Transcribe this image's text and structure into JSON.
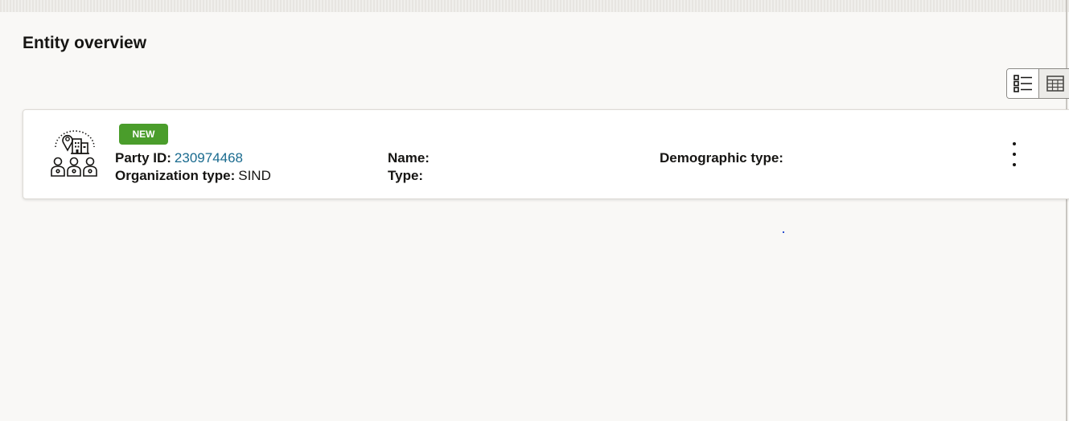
{
  "page": {
    "title": "Entity overview"
  },
  "view_toggle": {
    "list_icon": "list-view-icon",
    "table_icon": "table-view-icon",
    "selected": "list"
  },
  "entity_card": {
    "icon": "organization-people-icon",
    "badge": "NEW",
    "party_id_label": "Party ID:",
    "party_id_value": "230974468",
    "org_type_label": "Organization type:",
    "org_type_value": "SIND",
    "name_label": "Name:",
    "name_value": "",
    "type_label": "Type:",
    "type_value": "",
    "demographic_label": "Demographic type:",
    "demographic_value": "",
    "menu_icon": "more-vertical-icon"
  },
  "colors": {
    "badge": "#4a9d2b",
    "link": "#1a6b8f",
    "background": "#f9f8f6"
  }
}
